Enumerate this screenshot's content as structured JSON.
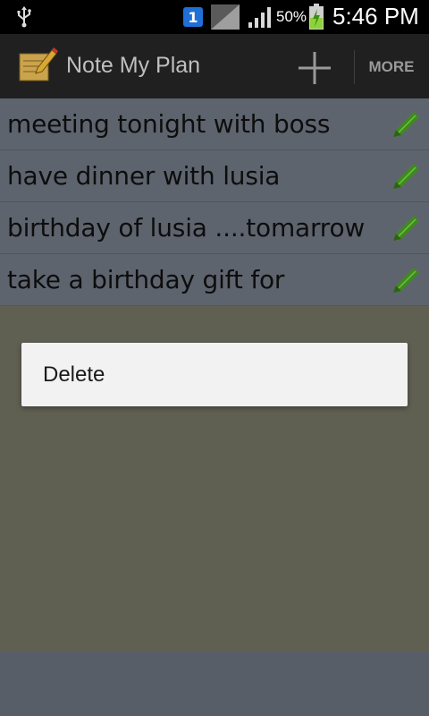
{
  "status_bar": {
    "battery_percent": "50%",
    "time": "5:46 PM",
    "sim_slot": "1"
  },
  "action_bar": {
    "title": "Note My Plan",
    "more_label": "MORE"
  },
  "notes": [
    {
      "text": "meeting tonight with  boss"
    },
    {
      "text": "have dinner with lusia"
    },
    {
      "text": "birthday of lusia ....tomarrow"
    },
    {
      "text": "take a birthday gift for"
    }
  ],
  "context_menu": {
    "items": [
      {
        "label": "Delete"
      }
    ]
  },
  "colors": {
    "pencil_green": "#3f8a1f",
    "action_bar_bg": "#202020",
    "list_bg": "#5e646e"
  },
  "icons": {
    "status": [
      "usb-icon",
      "sim-icon",
      "no-signal-icon",
      "signal-bars-icon",
      "battery-charging-icon"
    ],
    "action": [
      "app-notepad-icon",
      "add-icon"
    ],
    "row": "edit-pencil-icon"
  }
}
